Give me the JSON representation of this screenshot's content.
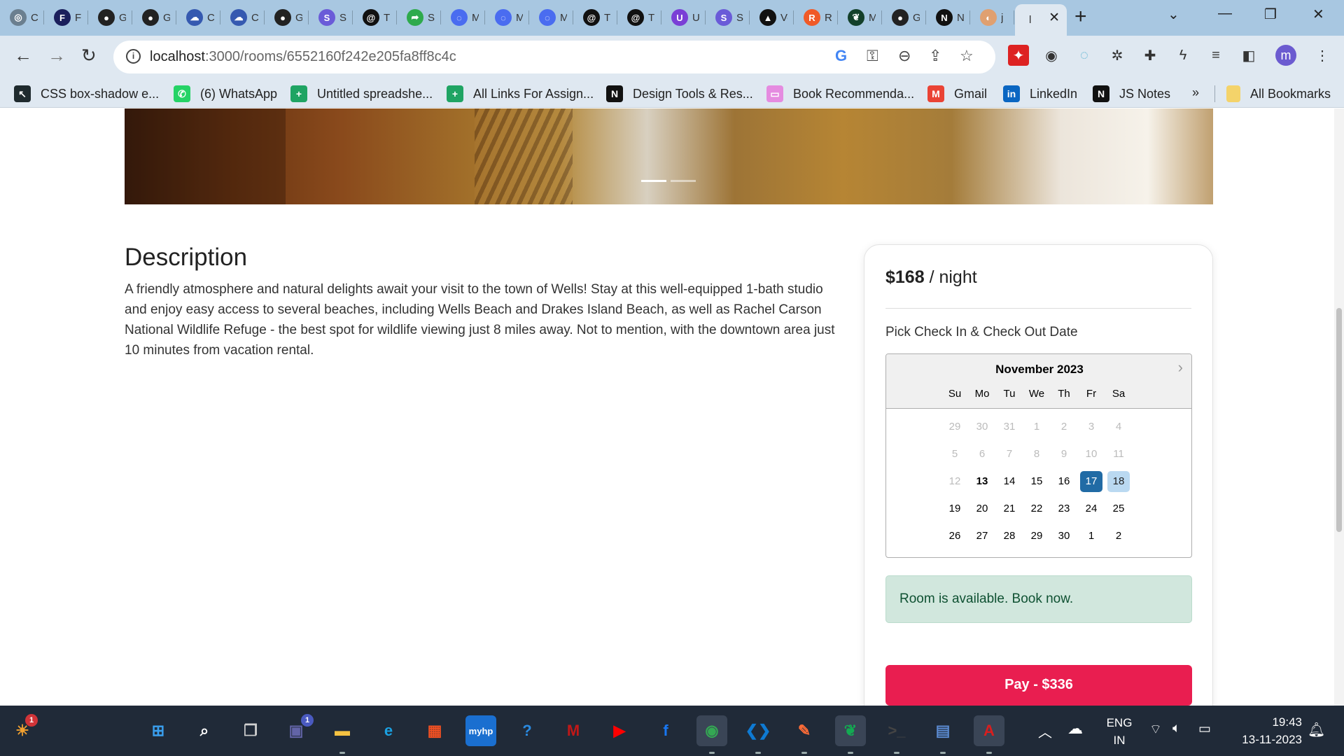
{
  "browser": {
    "tabs": [
      {
        "title": "ChatGPT",
        "icon": "chatgpt-icon",
        "color": "#6b7f8f",
        "glyph": "◎"
      },
      {
        "title": "F",
        "icon": "f-icon",
        "color": "#1b1f5c",
        "glyph": "F"
      },
      {
        "title": "GitHub",
        "icon": "github-icon",
        "color": "#222222",
        "glyph": "●"
      },
      {
        "title": "GitHub",
        "icon": "github-icon",
        "color": "#222222",
        "glyph": "●"
      },
      {
        "title": "Codeforces",
        "icon": "cloud-icon",
        "color": "#3559b0",
        "glyph": "☁"
      },
      {
        "title": "Codeforces",
        "icon": "cloud-icon",
        "color": "#3559b0",
        "glyph": "☁"
      },
      {
        "title": "GitHub",
        "icon": "github-icon",
        "color": "#222222",
        "glyph": "●"
      },
      {
        "title": "Stripe",
        "icon": "stripe-icon",
        "color": "#6a5bd8",
        "glyph": "S"
      },
      {
        "title": "Threads",
        "icon": "threads-icon",
        "color": "#111111",
        "glyph": "@"
      },
      {
        "title": "Share",
        "icon": "share-icon",
        "color": "#2eaa4c",
        "glyph": "➦"
      },
      {
        "title": "Messenger",
        "icon": "messenger-icon",
        "color": "#4a6cf0",
        "glyph": "◌"
      },
      {
        "title": "Messenger",
        "icon": "messenger-icon",
        "color": "#4a6cf0",
        "glyph": "◌"
      },
      {
        "title": "Messenger",
        "icon": "messenger-icon",
        "color": "#4a6cf0",
        "glyph": "◌"
      },
      {
        "title": "Threads",
        "icon": "threads-icon",
        "color": "#111111",
        "glyph": "@"
      },
      {
        "title": "Threads",
        "icon": "threads-icon",
        "color": "#111111",
        "glyph": "@"
      },
      {
        "title": "Upstash",
        "icon": "u-icon",
        "color": "#7a3fd6",
        "glyph": "U"
      },
      {
        "title": "Stripe",
        "icon": "stripe-icon",
        "color": "#6a5bd8",
        "glyph": "S"
      },
      {
        "title": "Vercel",
        "icon": "vercel-icon",
        "color": "#111111",
        "glyph": "▲"
      },
      {
        "title": "Render",
        "icon": "r-icon",
        "color": "#f05a28",
        "glyph": "R"
      },
      {
        "title": "MongoDB",
        "icon": "mongodb-icon",
        "color": "#13402a",
        "glyph": "❦"
      },
      {
        "title": "GitHub",
        "icon": "github-icon",
        "color": "#222222",
        "glyph": "●"
      },
      {
        "title": "Next.js",
        "icon": "nextjs-icon",
        "color": "#111111",
        "glyph": "N"
      },
      {
        "title": "j",
        "icon": "loading-icon",
        "color": "#e0a070",
        "glyph": "◐"
      }
    ],
    "active_tab_title": "l",
    "url_host": "localhost",
    "url_path": ":3000/rooms/6552160f242e205fa8ff8c4c",
    "bookmarks": [
      {
        "label": "CSS box-shadow e...",
        "icon": "css-icon",
        "color": "#1f2a2e",
        "glyph": "↖"
      },
      {
        "label": "(6) WhatsApp",
        "icon": "whatsapp-icon",
        "color": "#25d366",
        "glyph": "✆"
      },
      {
        "label": "Untitled spreadshe...",
        "icon": "sheets-icon",
        "color": "#1fa463",
        "glyph": "+"
      },
      {
        "label": "All Links For Assign...",
        "icon": "sheets-icon",
        "color": "#1fa463",
        "glyph": "+"
      },
      {
        "label": "Design Tools & Res...",
        "icon": "notion-icon",
        "color": "#111111",
        "glyph": "N"
      },
      {
        "label": "Book Recommenda...",
        "icon": "bookmark-image-icon",
        "color": "#e58be0",
        "glyph": "▭"
      },
      {
        "label": "Gmail",
        "icon": "gmail-icon",
        "color": "#ea4335",
        "glyph": "M"
      },
      {
        "label": "LinkedIn",
        "icon": "linkedin-icon",
        "color": "#0a66c2",
        "glyph": "in"
      },
      {
        "label": "JS Notes",
        "icon": "notion-icon",
        "color": "#111111",
        "glyph": "N"
      }
    ],
    "more_bookmarks": "»",
    "all_bookmarks": "All Bookmarks",
    "profile_initial": "m"
  },
  "page": {
    "description_title": "Description",
    "description_text": "A friendly atmosphere and natural delights await your visit to the town of Wells! Stay at this well-equipped 1-bath studio and enjoy easy access to several beaches, including Wells Beach and Drakes Island Beach, as well as Rachel Carson National Wildlife Refuge - the best spot for wildlife viewing just 8 miles away. Not to mention, with the downtown area just 10 minutes from vacation rental.",
    "price_amount": "$168",
    "price_unit": " / night",
    "pick_label": "Pick Check In & Check Out Date",
    "calendar": {
      "month": "November 2023",
      "days_of_week": [
        "Su",
        "Mo",
        "Tu",
        "We",
        "Th",
        "Fr",
        "Sa"
      ],
      "weeks": [
        [
          {
            "d": "29",
            "s": "out"
          },
          {
            "d": "30",
            "s": "out"
          },
          {
            "d": "31",
            "s": "out"
          },
          {
            "d": "1",
            "s": "out"
          },
          {
            "d": "2",
            "s": "out"
          },
          {
            "d": "3",
            "s": "out"
          },
          {
            "d": "4",
            "s": "out"
          }
        ],
        [
          {
            "d": "5",
            "s": "out"
          },
          {
            "d": "6",
            "s": "out"
          },
          {
            "d": "7",
            "s": "out"
          },
          {
            "d": "8",
            "s": "out"
          },
          {
            "d": "9",
            "s": "out"
          },
          {
            "d": "10",
            "s": "out"
          },
          {
            "d": "11",
            "s": "out"
          }
        ],
        [
          {
            "d": "12",
            "s": "out"
          },
          {
            "d": "13",
            "s": "today"
          },
          {
            "d": "14",
            "s": ""
          },
          {
            "d": "15",
            "s": ""
          },
          {
            "d": "16",
            "s": ""
          },
          {
            "d": "17",
            "s": "sel"
          },
          {
            "d": "18",
            "s": "inrange"
          }
        ],
        [
          {
            "d": "19",
            "s": ""
          },
          {
            "d": "20",
            "s": ""
          },
          {
            "d": "21",
            "s": ""
          },
          {
            "d": "22",
            "s": ""
          },
          {
            "d": "23",
            "s": ""
          },
          {
            "d": "24",
            "s": ""
          },
          {
            "d": "25",
            "s": ""
          }
        ],
        [
          {
            "d": "26",
            "s": ""
          },
          {
            "d": "27",
            "s": ""
          },
          {
            "d": "28",
            "s": ""
          },
          {
            "d": "29",
            "s": ""
          },
          {
            "d": "30",
            "s": ""
          },
          {
            "d": "1",
            "s": ""
          },
          {
            "d": "2",
            "s": ""
          }
        ]
      ]
    },
    "availability_text": "Room is available. Book now.",
    "pay_label": "Pay - $336",
    "colors": {
      "pay": "#e91e50",
      "selected_day": "#216ba5",
      "range_day": "#bad9f1",
      "alert_bg": "#d1e7dd"
    }
  },
  "taskbar": {
    "apps": [
      {
        "name": "widgets",
        "glyph": "☀",
        "color": "#f0a030"
      },
      {
        "name": "start",
        "glyph": "⊞",
        "color": "#3aa0f0"
      },
      {
        "name": "search",
        "glyph": "⌕",
        "color": "#ffffff"
      },
      {
        "name": "task-view",
        "glyph": "❐",
        "color": "#d0d0d0"
      },
      {
        "name": "teams",
        "glyph": "▣",
        "color": "#6264a7"
      },
      {
        "name": "file-explorer",
        "glyph": "▬",
        "color": "#f5c242"
      },
      {
        "name": "edge",
        "glyph": "e",
        "color": "#1ba1e2"
      },
      {
        "name": "store",
        "glyph": "▦",
        "color": "#f25022"
      },
      {
        "name": "myhp",
        "glyph": "myhp",
        "color": "#1a6fd0"
      },
      {
        "name": "help",
        "glyph": "?",
        "color": "#2a8ae0"
      },
      {
        "name": "mcafee",
        "glyph": "M",
        "color": "#c01818"
      },
      {
        "name": "youtube",
        "glyph": "▶",
        "color": "#ff0000"
      },
      {
        "name": "facebook",
        "glyph": "f",
        "color": "#1877f2"
      },
      {
        "name": "chrome",
        "glyph": "◉",
        "color": "#34a853"
      },
      {
        "name": "vscode",
        "glyph": "❮❯",
        "color": "#0e7ad3"
      },
      {
        "name": "postman",
        "glyph": "✎",
        "color": "#ff6c37"
      },
      {
        "name": "mongodb-compass",
        "glyph": "❦",
        "color": "#13aa52"
      },
      {
        "name": "terminal",
        "glyph": ">_",
        "color": "#444444"
      },
      {
        "name": "remote-desktop",
        "glyph": "▤",
        "color": "#5a8ad0"
      },
      {
        "name": "acrobat",
        "glyph": "A",
        "color": "#d81e1e"
      }
    ],
    "widget_badge": "1",
    "teams_badge": "1",
    "language_top": "ENG",
    "language_bottom": "IN",
    "time": "19:43",
    "date": "13-11-2023"
  }
}
